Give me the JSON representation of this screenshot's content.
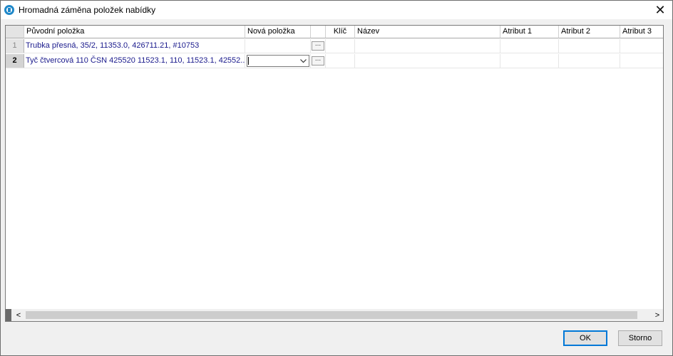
{
  "window": {
    "title": "Hromadná záměna položek nabídky",
    "close_glyph": "✕",
    "app_icon": "app-logo-icon"
  },
  "grid": {
    "columns": [
      {
        "key": "rownum",
        "label": ""
      },
      {
        "key": "puvodni",
        "label": "Původní položka"
      },
      {
        "key": "nova",
        "label": "Nová položka"
      },
      {
        "key": "btn",
        "label": ""
      },
      {
        "key": "klic",
        "label": "Klíč"
      },
      {
        "key": "nazev",
        "label": "Název"
      },
      {
        "key": "atr1",
        "label": "Atribut 1"
      },
      {
        "key": "atr2",
        "label": "Atribut 2"
      },
      {
        "key": "atr3",
        "label": "Atribut 3"
      }
    ],
    "rows": [
      {
        "num": "1",
        "puvodni": "Trubka přesná, 35/2, 11353.0, 426711.21, #10753",
        "nova": "",
        "btn": "...",
        "klic": "",
        "nazev": "",
        "atr1": "",
        "atr2": "",
        "atr3": ""
      },
      {
        "num": "2",
        "puvodni": "Tyč čtvercová 110 ČSN 425520 11523.1, 110, 11523.1, 42552...",
        "nova": "",
        "btn": "...",
        "klic": "",
        "nazev": "",
        "atr1": "",
        "atr2": "",
        "atr3": ""
      }
    ],
    "current_row": 2
  },
  "scrollbar": {
    "left_arrow": "<",
    "right_arrow": ">"
  },
  "buttons": {
    "ok": "OK",
    "storno": "Storno"
  }
}
